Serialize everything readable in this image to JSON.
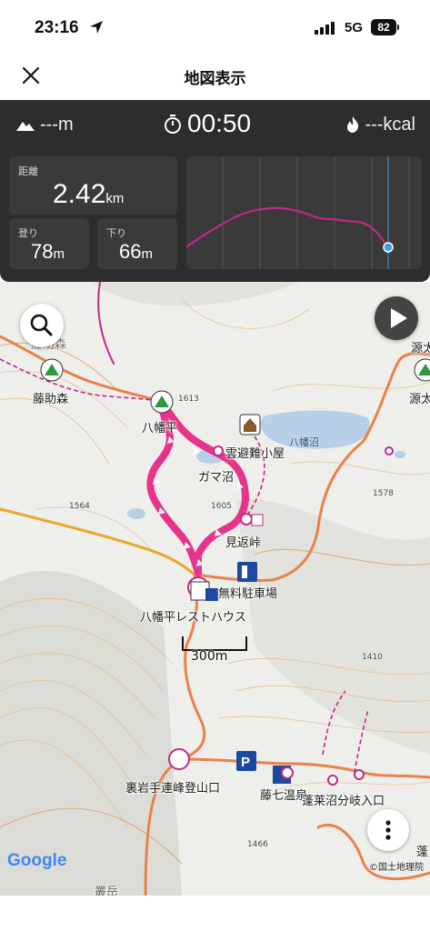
{
  "status": {
    "time": "23:16",
    "network": "5G",
    "battery": "82"
  },
  "header": {
    "title": "地図表示"
  },
  "stats": {
    "altitude": "---m",
    "elapsed": "00:50",
    "calories": "---kcal",
    "distance_label": "距離",
    "distance_value": "2.42",
    "distance_unit": "km",
    "ascent_label": "登り",
    "ascent_value": "78",
    "ascent_unit": "m",
    "descent_label": "下り",
    "descent_value": "66",
    "descent_unit": "m"
  },
  "map": {
    "labels": {
      "fujisuke": "藤助森",
      "fujisuke_partial": "藤助森",
      "hachimantai": "八幡平",
      "hut": "雲避難小屋",
      "gamanuma": "ガマ沼",
      "hachimanuma": "八幡沼",
      "mikaeri": "見返峠",
      "parking": "無料駐車場",
      "resthouse": "八幡平レストハウス",
      "trailhead": "裏岩手連峰登山口",
      "fujishichi": "藤七温泉",
      "horai_junction": "蓬莱沼分岐入口",
      "genta": "源太",
      "genta2": "源太",
      "horai": "蓬",
      "bottom_left": "叢岳"
    },
    "elevations": {
      "e1": "1564",
      "e2": "1605",
      "e3": "1578",
      "e4": "1410",
      "e5": "1466",
      "e6": "1613"
    },
    "scale": "300m",
    "google": "Google",
    "attribution": "©国土地理院"
  },
  "colors": {
    "route": "#e8338a",
    "road": "#e8824a",
    "panel": "#2d2d2d",
    "water": "#b8cfe8",
    "graph_line": "#c0298a",
    "position": "#3aa0e0"
  }
}
